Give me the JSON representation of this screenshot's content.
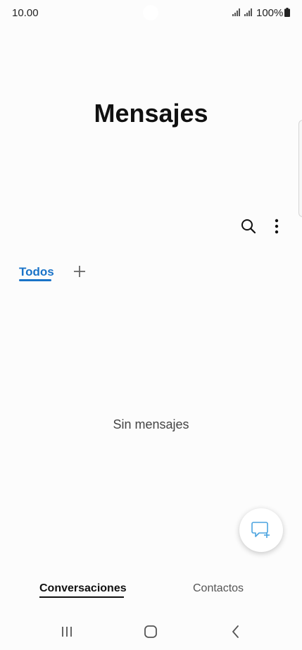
{
  "status_bar": {
    "time": "10.00",
    "battery": "100%"
  },
  "header": {
    "title": "Mensajes"
  },
  "actions": {
    "search_icon": "search-icon",
    "more_icon": "more-vertical-icon"
  },
  "tabs": {
    "items": [
      {
        "label": "Todos",
        "active": true
      }
    ],
    "add_icon": "plus-icon"
  },
  "empty_state": {
    "text": "Sin mensajes"
  },
  "fab": {
    "icon": "new-message-icon"
  },
  "bottom_tabs": {
    "items": [
      {
        "label": "Conversaciones",
        "active": true
      },
      {
        "label": "Contactos",
        "active": false
      }
    ]
  },
  "colors": {
    "accent": "#1a73c8",
    "background": "#fcfcfc",
    "fab_icon": "#4aa3df"
  },
  "nav_bar": {
    "recents_icon": "recents-icon",
    "home_icon": "home-icon",
    "back_icon": "back-icon"
  }
}
